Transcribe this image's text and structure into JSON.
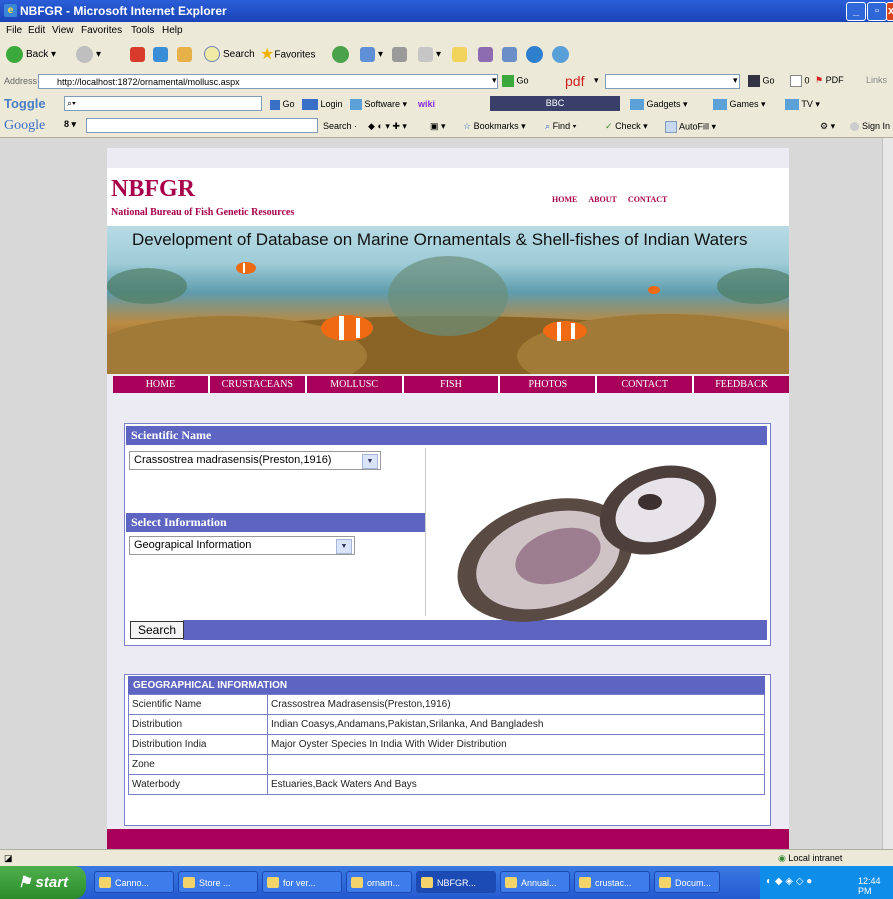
{
  "window": {
    "title": "NBFGR - Microsoft Internet Explorer"
  },
  "menu": [
    "File",
    "Edit",
    "View",
    "Favorites",
    "Tools",
    "Help"
  ],
  "toolbar": {
    "back": "Back",
    "search": "Search",
    "favorites": "Favorites"
  },
  "address": {
    "label": "Address",
    "url": "http://localhost:1872/ornamental/mollusc.aspx",
    "go": "Go",
    "pdf_label": "pdf",
    "go2": "Go",
    "pdf_count": "0",
    "pdf": "PDF",
    "links": "Links"
  },
  "toggle_bar": {
    "toggle": "Toggle",
    "go": "Go",
    "login": "Login",
    "software": "Software",
    "wiki": "wiki",
    "bbc": "BBC",
    "gadgets": "Gadgets",
    "games": "Games",
    "tv": "TV"
  },
  "google_bar": {
    "logo": "Google",
    "search": "Search",
    "bookmarks": "Bookmarks",
    "find": "Find",
    "check": "Check",
    "autofill": "AutoFill",
    "signin": "Sign In"
  },
  "site": {
    "logo": "NBFGR",
    "logo_sub": "National Bureau of Fish Genetic Resources",
    "top_links": [
      "HOME",
      "ABOUT",
      "CONTACT"
    ],
    "banner_title": "Development of Database on Marine Ornamentals & Shell-fishes of Indian Waters",
    "nav": [
      "HOME",
      "CRUSTACEANS",
      "MOLLUSC",
      "FISH",
      "PHOTOS",
      "CONTACT",
      "FEEDBACK"
    ]
  },
  "search_panel": {
    "scientific_name_header": "Scientific Name",
    "scientific_name_value": "Crassostrea madrasensis(Preston,1916)",
    "select_info_header": "Select Information",
    "select_info_value": "Geograpical Information",
    "search_button": "Search"
  },
  "info": {
    "header": "GEOGRAPHICAL INFORMATION",
    "rows": [
      {
        "label": "Scientific Name",
        "value": "Crassostrea Madrasensis(Preston,1916)"
      },
      {
        "label": "Distribution",
        "value": "Indian Coasys,Andamans,Pakistan,Srilanka, And Bangladesh"
      },
      {
        "label": "Distribution India",
        "value": "Major Oyster Species In India With Wider Distribution"
      },
      {
        "label": "Zone",
        "value": ""
      },
      {
        "label": "Waterbody",
        "value": "Estuaries,Back Waters And Bays"
      }
    ]
  },
  "status": {
    "zone": "Local intranet"
  },
  "taskbar": {
    "start": "start",
    "tasks": [
      "Canno...",
      "Store ...",
      "for ver...",
      "ornam...",
      "NBFGR...",
      "Annual...",
      "crustac...",
      "Docum..."
    ],
    "clock": "12:44 PM"
  },
  "colors": {
    "brand": "#a8005a",
    "header_bar": "#5d64c2",
    "title_bar": "#1943b8"
  }
}
